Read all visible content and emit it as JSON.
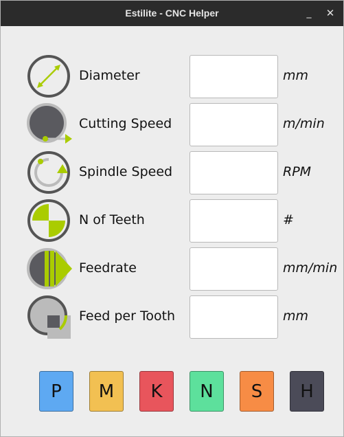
{
  "window": {
    "title": "Estilite - CNC Helper",
    "minimize": "_",
    "close": "✕"
  },
  "rows": [
    {
      "label": "Diameter",
      "unit": "mm",
      "value": "",
      "icon": "diameter-icon"
    },
    {
      "label": "Cutting Speed",
      "unit": "m/min",
      "value": "",
      "icon": "cutting-speed-icon"
    },
    {
      "label": "Spindle Speed",
      "unit": "RPM",
      "value": "",
      "icon": "spindle-speed-icon"
    },
    {
      "label": "N of Teeth",
      "unit": "#",
      "value": "",
      "icon": "teeth-icon"
    },
    {
      "label": "Feedrate",
      "unit": "mm/min",
      "value": "",
      "icon": "feedrate-icon"
    },
    {
      "label": "Feed per Tooth",
      "unit": "mm",
      "value": "",
      "icon": "feed-per-tooth-icon"
    }
  ],
  "materials": [
    {
      "label": "P",
      "color": "#5ea9f2"
    },
    {
      "label": "M",
      "color": "#f2c052"
    },
    {
      "label": "K",
      "color": "#e8555c"
    },
    {
      "label": "N",
      "color": "#5de09c"
    },
    {
      "label": "S",
      "color": "#f78c45"
    },
    {
      "label": "H",
      "color": "#4b4b58"
    }
  ],
  "colors": {
    "accent": "#aacc00",
    "icon_ring": "#555555",
    "icon_fill": "#5a5a5f"
  }
}
